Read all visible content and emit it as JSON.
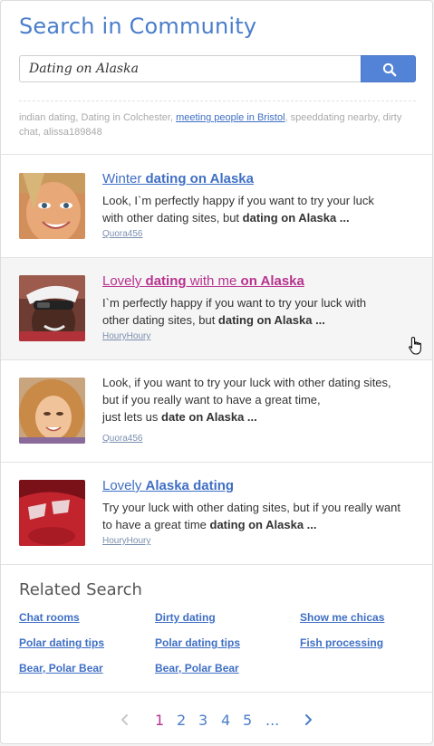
{
  "header": {
    "title": "Search in Community",
    "search_value": "Dating on Alaska",
    "search_icon": "search-icon",
    "suggestions_prefix": "indian dating, Dating in Colchester, ",
    "suggestions_link": "meeting people in Bristol",
    "suggestions_suffix": ", speeddating nearby, dirty chat, alissa189848"
  },
  "results": [
    {
      "title_a": "Winter ",
      "title_b": "dating on Alaska",
      "title_c": "",
      "title_d": "",
      "line1": "Look, I`m perfectly happy if you want to try your luck",
      "line2a": "with other dating sites, but ",
      "line2b": "dating on Alaska ...",
      "author": "Quora456"
    },
    {
      "title_a": "Lovely ",
      "title_b": "dating",
      "title_c": " with me ",
      "title_d": "on Alaska",
      "line1": "I`m perfectly happy if you want to try your luck with",
      "line2a": "other dating sites, but ",
      "line2b": "dating on Alaska ...",
      "author": "HouryHoury"
    },
    {
      "line1": "Look, if you want to try your luck with other dating sites,",
      "line2": "but if you really want to have a great time,",
      "line3a": "just lets us ",
      "line3b": "date on Alaska ...",
      "author": "Quora456"
    },
    {
      "title_a": "Lovely ",
      "title_b": "Alaska dating",
      "line1": "Try your luck with other dating sites, but if you really want",
      "line2a": "to have a great time ",
      "line2b": "dating on Alaska ...",
      "author": "HouryHoury"
    }
  ],
  "related": {
    "title": "Related Search",
    "links": [
      "Chat rooms",
      "Dirty dating",
      "Show me chicas",
      "Polar dating tips",
      "Polar dating tips",
      "Fish processing",
      "Bear, Polar Bear",
      "Bear, Polar Bear"
    ]
  },
  "pagination": {
    "pages": [
      "1",
      "2",
      "3",
      "4",
      "5"
    ],
    "ellipsis": "...",
    "current": "1",
    "prev_icon": "chevron-left-icon",
    "next_icon": "chevron-right-icon"
  },
  "colors": {
    "accent": "#4a7ecb",
    "button": "#5283d6",
    "highlight_link": "#b8328f"
  }
}
